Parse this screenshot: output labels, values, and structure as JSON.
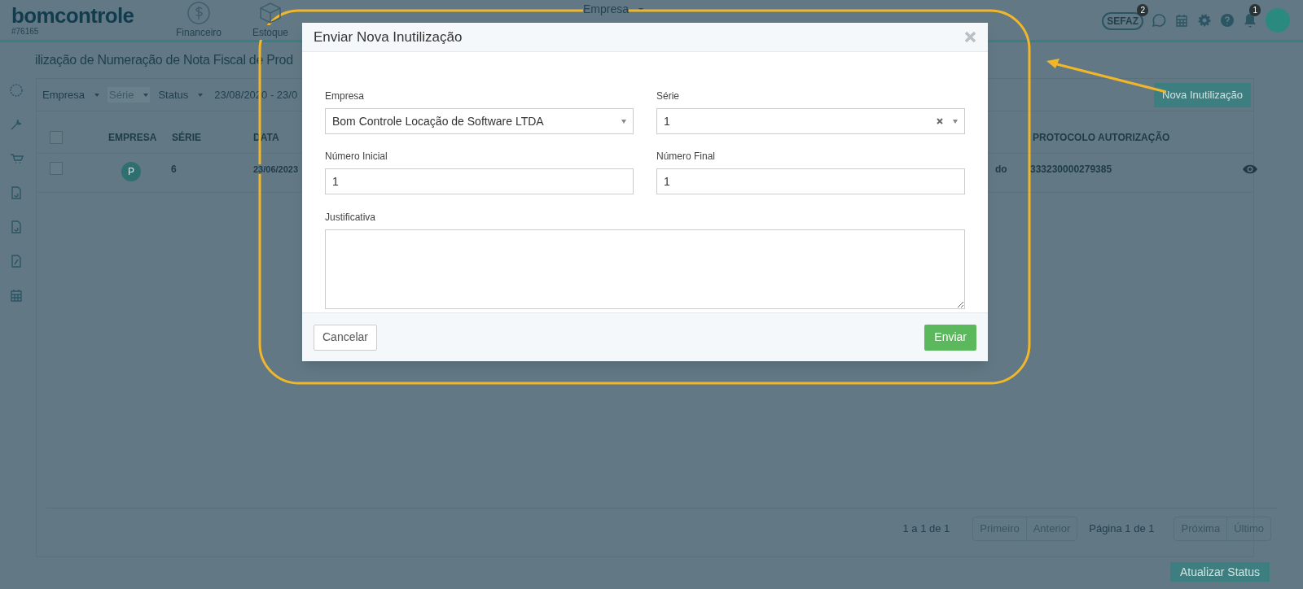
{
  "header": {
    "logo": "bomcontrole",
    "account": "#76165",
    "nav": [
      {
        "kind": "dollar",
        "label": "Financeiro"
      },
      {
        "kind": "box",
        "label": "Estoque"
      }
    ],
    "company_menu": "Empresa",
    "sefaz": {
      "label": "SEFAZ",
      "badge": "2"
    },
    "notifications_badge": "1"
  },
  "page": {
    "title": "ilização de Numeração de Nota Fiscal de Prod",
    "filters": [
      {
        "label": "Empresa",
        "disabled": false
      },
      {
        "label": "Série",
        "disabled": true
      },
      {
        "label": "Status",
        "disabled": false
      }
    ],
    "date_range": "23/08/2020 - 23/0",
    "new_button": "Nova Inutilização",
    "table": {
      "select_all_checked": false,
      "columns": [
        "EMPRESA",
        "SÉRIE",
        "DATA",
        "PROTOCOLO AUTORIZAÇÃO"
      ],
      "rows": [
        {
          "checked": false,
          "company_initial": "P",
          "serie": "6",
          "date": "23/06/2023",
          "column_5": "do",
          "protocol": "333230000279385"
        }
      ]
    },
    "pagination": {
      "summary": "1 a 1 de 1",
      "first": "Primeiro",
      "previous": "Anterior",
      "page": "Página 1 de 1",
      "next": "Próxima",
      "last": "Último"
    },
    "refresh_button": "Atualizar Status"
  },
  "modal": {
    "title": "Enviar Nova Inutilização",
    "fields": [
      {
        "kind": "select",
        "label": "Empresa",
        "value": "Bom Controle Locação de Software LTDA",
        "clearable": false
      },
      {
        "kind": "select",
        "label": "Série",
        "value": "1",
        "clearable": true
      },
      {
        "kind": "input",
        "label": "Número Inicial",
        "value": "1"
      },
      {
        "kind": "input",
        "label": "Número Final",
        "value": "1"
      },
      {
        "kind": "textarea",
        "label": "Justificativa"
      }
    ],
    "cancel": "Cancelar",
    "submit": "Enviar"
  }
}
